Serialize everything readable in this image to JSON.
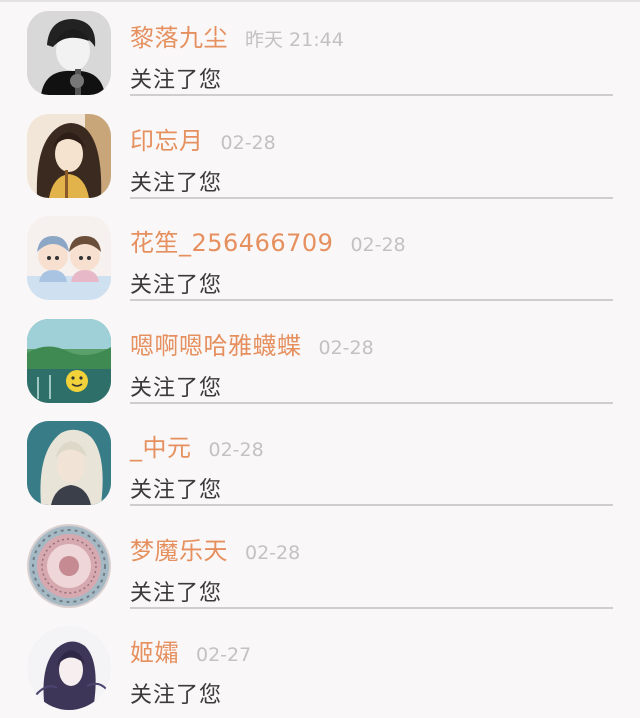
{
  "notifications": [
    {
      "name": "黎落九尘",
      "time": "昨天 21:44",
      "message": "关注了您",
      "avatar": "avatar-monochrome-boy"
    },
    {
      "name": "印忘月",
      "time": "02-28",
      "message": "关注了您",
      "avatar": "avatar-long-hair-figure"
    },
    {
      "name": "花笙_256466709",
      "time": "02-28",
      "message": "关注了您",
      "avatar": "avatar-chibi-pair"
    },
    {
      "name": "嗯啊嗯哈雅蠛蝶",
      "time": "02-28",
      "message": "关注了您",
      "avatar": "avatar-green-landscape-smiley"
    },
    {
      "name": "_中元",
      "time": "02-28",
      "message": "关注了您",
      "avatar": "avatar-silver-hair-anime"
    },
    {
      "name": "梦魔乐天",
      "time": "02-28",
      "message": "关注了您",
      "avatar": "avatar-circular-pattern"
    },
    {
      "name": "姬孀",
      "time": "02-27",
      "message": "关注了您",
      "avatar": "avatar-dark-hair-sketch"
    }
  ],
  "colors": {
    "name": "#e5905e",
    "time": "#c3c1c2",
    "message": "#3a3a3a",
    "divider": "#cfcdce",
    "background": "#f9f7f8"
  }
}
